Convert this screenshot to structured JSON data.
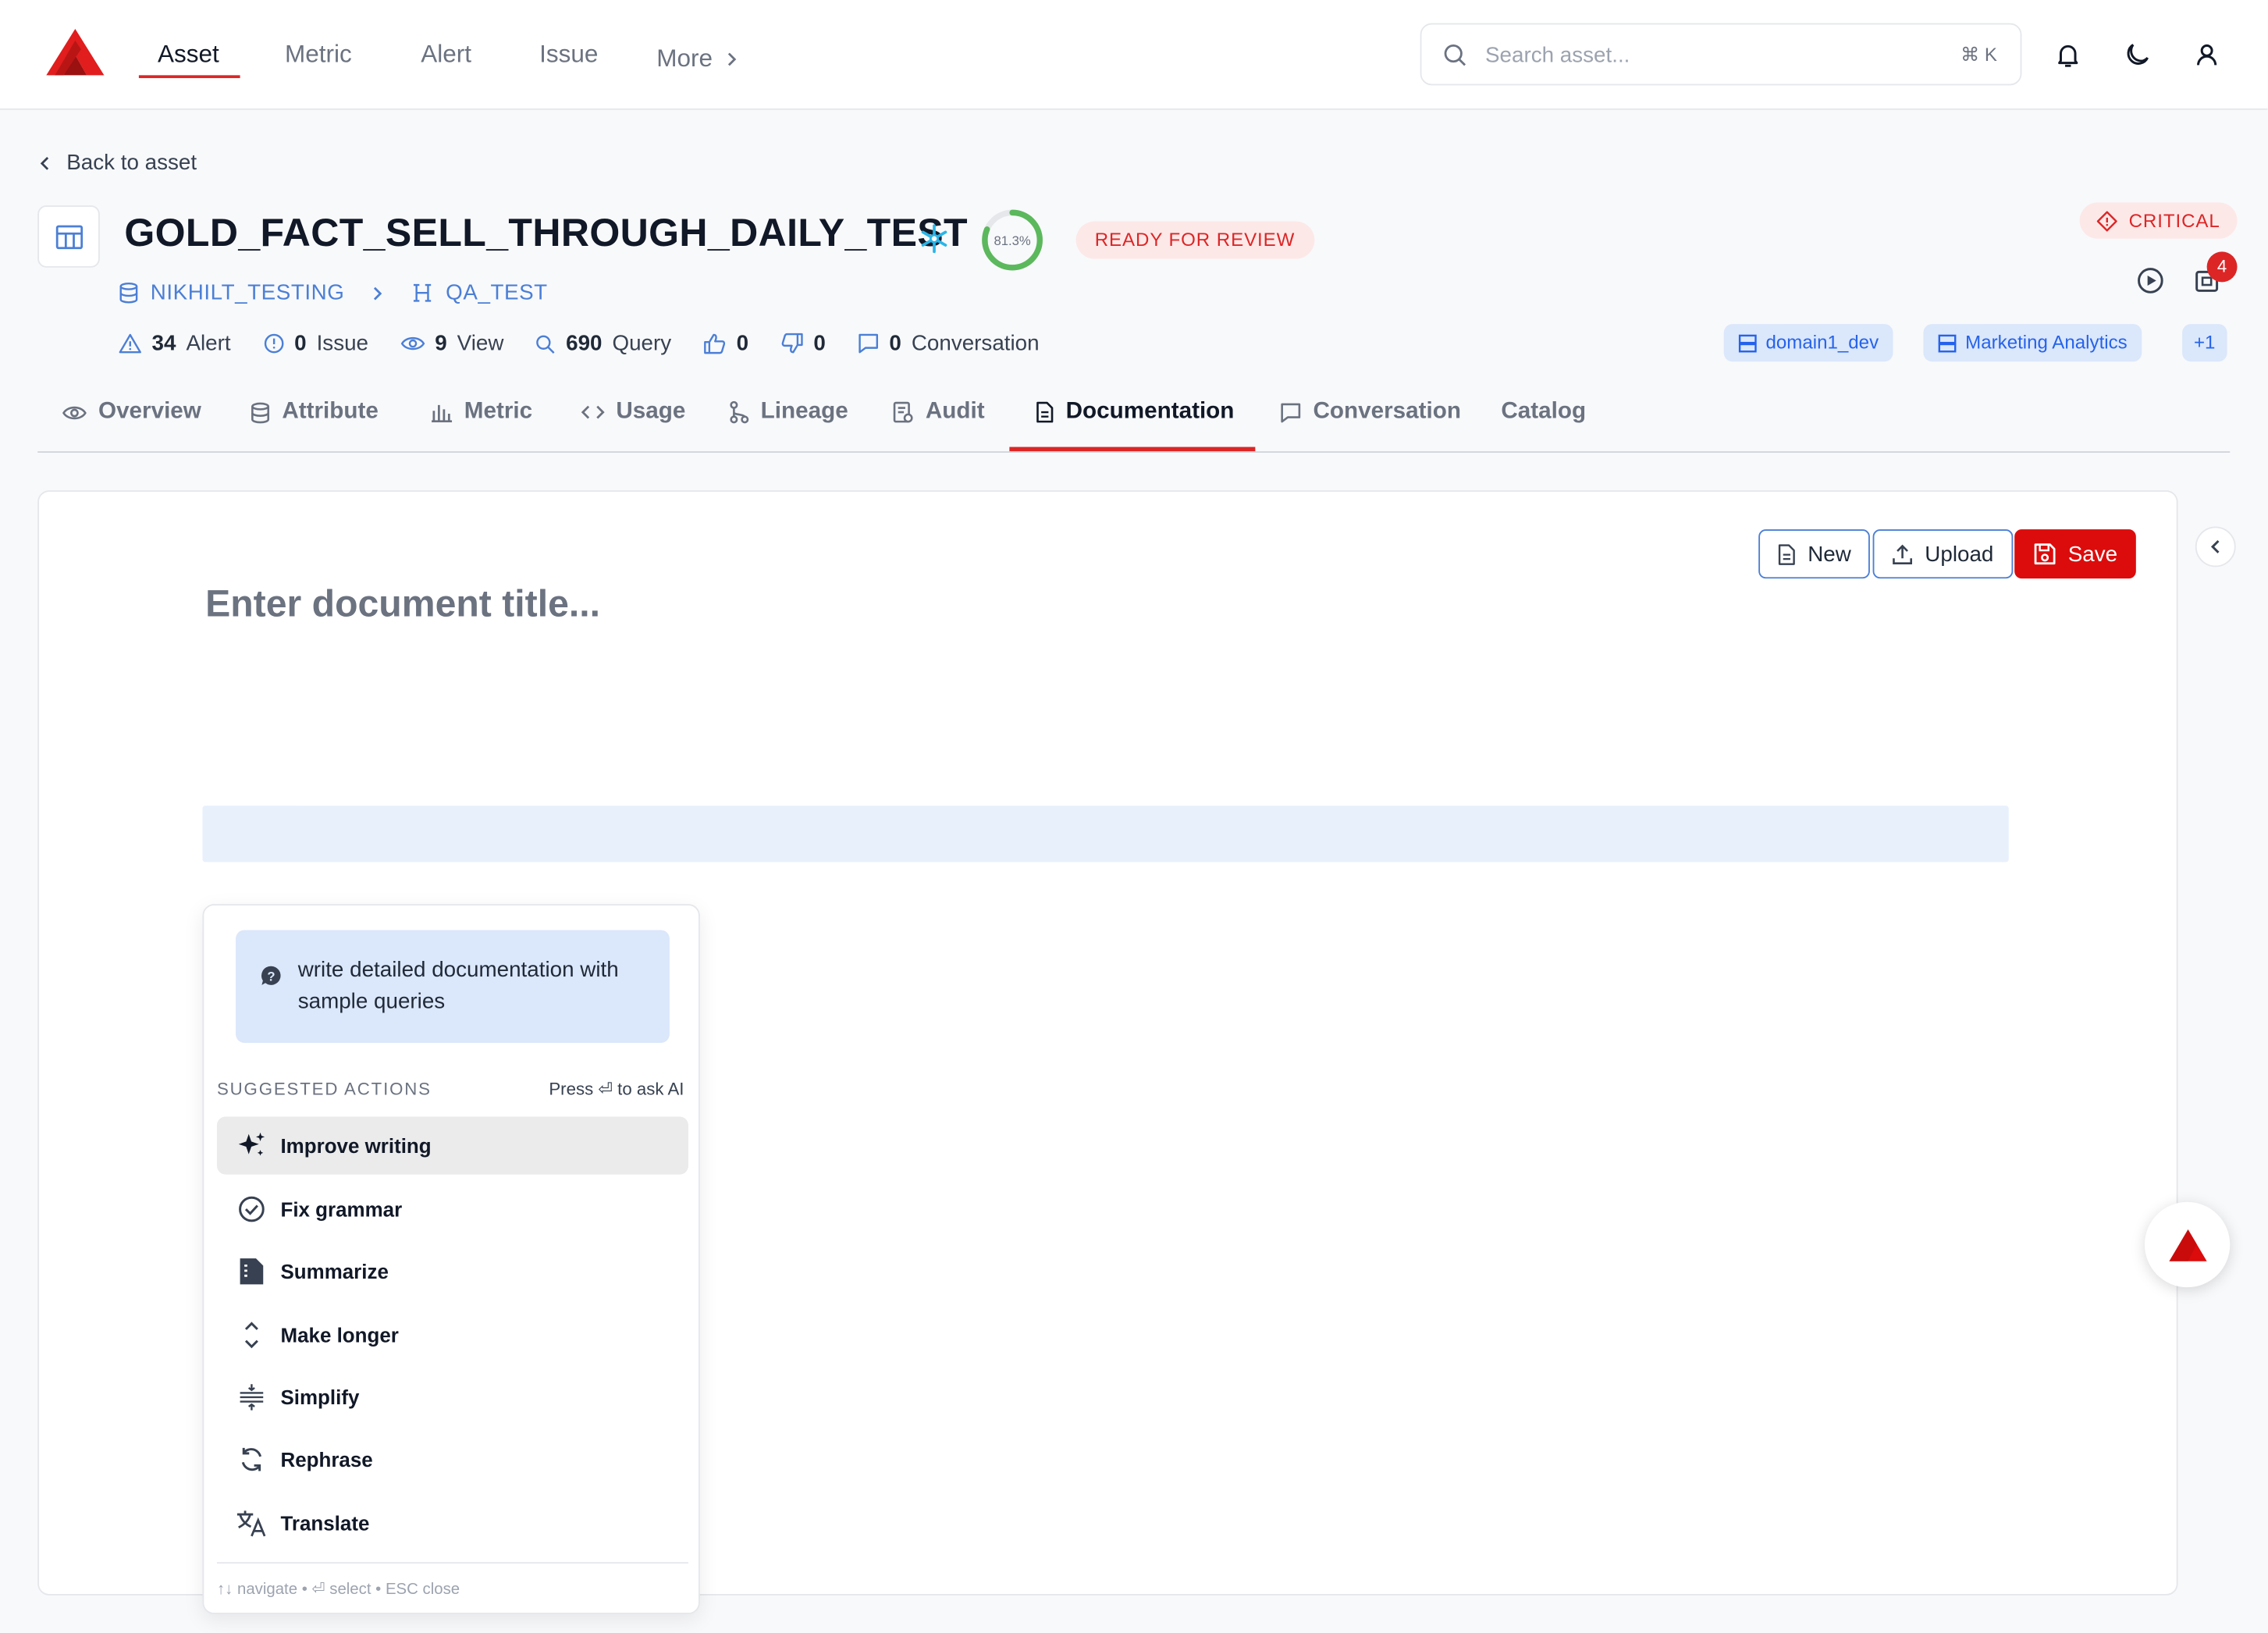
{
  "nav": {
    "items": [
      "Asset",
      "Metric",
      "Alert",
      "Issue",
      "More"
    ],
    "search_placeholder": "Search asset...",
    "search_shortcut": "⌘ K"
  },
  "header": {
    "back_label": "Back to asset",
    "title": "GOLD_FACT_SELL_THROUGH_DAILY_TEST",
    "score": "81.3%",
    "score_value": 81.3,
    "status": "READY FOR REVIEW",
    "priority": "CRITICAL",
    "notification_count": "4",
    "crumbs": [
      "NIKHILT_TESTING",
      "QA_TEST"
    ],
    "stats": {
      "alert_count": "34",
      "alert_label": "Alert",
      "issue_count": "0",
      "issue_label": "Issue",
      "view_count": "9",
      "view_label": "View",
      "query_count": "690",
      "query_label": "Query",
      "likes": "0",
      "dislikes": "0",
      "conversation_count": "0",
      "conversation_label": "Conversation"
    },
    "tags": [
      "domain1_dev",
      "Marketing Analytics",
      "+1"
    ]
  },
  "tabs": [
    "Overview",
    "Attribute",
    "Metric",
    "Usage",
    "Lineage",
    "Audit",
    "Documentation",
    "Conversation",
    "Catalog"
  ],
  "editor": {
    "new_label": "New",
    "upload_label": "Upload",
    "save_label": "Save",
    "title_placeholder": "Enter document title..."
  },
  "ai_popup": {
    "prompt": "write detailed documentation with sample queries",
    "suggested_label": "SUGGESTED ACTIONS",
    "press_hint": "Press ⏎ to ask AI",
    "actions": [
      "Improve writing",
      "Fix grammar",
      "Summarize",
      "Make longer",
      "Simplify",
      "Rephrase",
      "Translate"
    ],
    "footer": "↑↓ navigate • ⏎ select • ESC close"
  },
  "colors": {
    "brand_red": "#dc2626",
    "link_blue": "#4b7fd6",
    "tag_bg": "#dbe7fb",
    "score_green": "#5cb85c"
  }
}
